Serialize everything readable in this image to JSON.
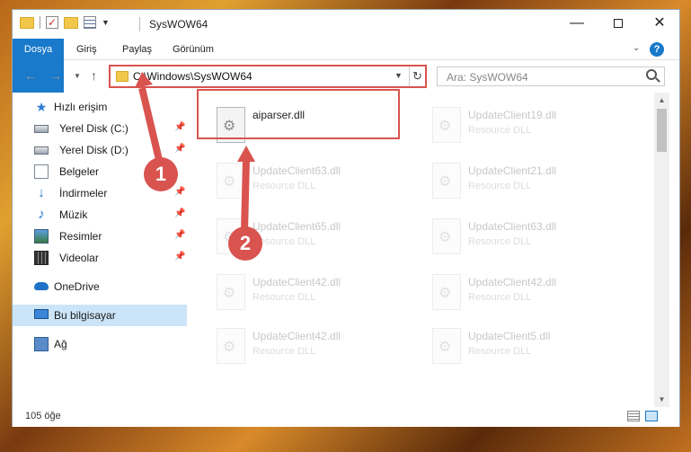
{
  "titlebar": {
    "title": "SysWOW64",
    "minimize": "—",
    "close": "✕"
  },
  "ribbon": {
    "file_tab": "Dosya",
    "tabs": [
      "Giriş",
      "Paylaş",
      "Görünüm"
    ],
    "help": "?"
  },
  "address": {
    "path": "C:\\Windows\\SysWOW64",
    "refresh": "↻"
  },
  "search": {
    "placeholder": "Ara: SysWOW64"
  },
  "sidebar": {
    "quick_access": "Hızlı erişim",
    "items": [
      {
        "label": "Yerel Disk (C:)",
        "icon": "drive-icon"
      },
      {
        "label": "Yerel Disk (D:)",
        "icon": "drive-icon"
      },
      {
        "label": "Belgeler",
        "icon": "documents-icon"
      },
      {
        "label": "İndirmeler",
        "icon": "download-icon"
      },
      {
        "label": "Müzik",
        "icon": "music-icon"
      },
      {
        "label": "Resimler",
        "icon": "pictures-icon"
      },
      {
        "label": "Videolar",
        "icon": "videos-icon"
      }
    ],
    "onedrive": "OneDrive",
    "this_pc": "Bu bilgisayar",
    "network": "Ağ"
  },
  "files": [
    {
      "name": "aiparser.dll",
      "type": ""
    },
    {
      "name": "UpdateClient19.dll",
      "type": "Resource DLL"
    },
    {
      "name": "UpdateClient63.dll",
      "type": "Resource DLL"
    },
    {
      "name": "UpdateClient21.dll",
      "type": "Resource DLL"
    },
    {
      "name": "UpdateClient65.dll",
      "type": "Resource DLL"
    },
    {
      "name": "UpdateClient63.dll",
      "type": "Resource DLL"
    },
    {
      "name": "UpdateClient42.dll",
      "type": "Resource DLL"
    },
    {
      "name": "UpdateClient42.dll",
      "type": "Resource DLL"
    },
    {
      "name": "UpdateClient42.dll",
      "type": "Resource DLL"
    },
    {
      "name": "UpdateClient5.dll",
      "type": "Resource DLL"
    }
  ],
  "status": {
    "item_count": "105 öğe"
  },
  "callouts": [
    "1",
    "2"
  ],
  "colors": {
    "accent": "#1979ca",
    "highlight": "#d9534f",
    "selected": "#cce4f7"
  }
}
